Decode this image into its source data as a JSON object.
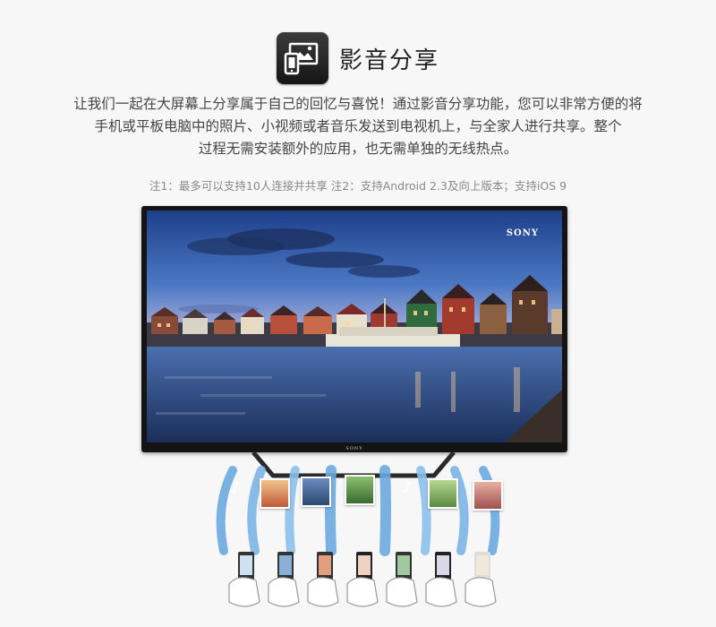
{
  "header": {
    "icon": "screen-share-icon",
    "title": "影音分享"
  },
  "description": {
    "line1": "让我们一起在大屏幕上分享属于自己的回忆与喜悦！通过影音分享功能，您可以非常方便的将",
    "line2": "手机或平板电脑中的照片、小视频或者音乐发送到电视机上，与全家人进行共享。整个",
    "line3": "过程无需安装额外的应用，也无需单独的无线热点。"
  },
  "note": "注1：最多可以支持10人连接并共享 注2：支持Android 2.3及向上版本；支持iOS 9",
  "tv": {
    "brand_top": "SONY",
    "brand_bottom": "SONY"
  },
  "media_thumbs": {
    "music_symbol": "♪"
  },
  "colors": {
    "background": "#f7f7f7",
    "wave": "#6aa8e0",
    "bezel": "#141414"
  }
}
